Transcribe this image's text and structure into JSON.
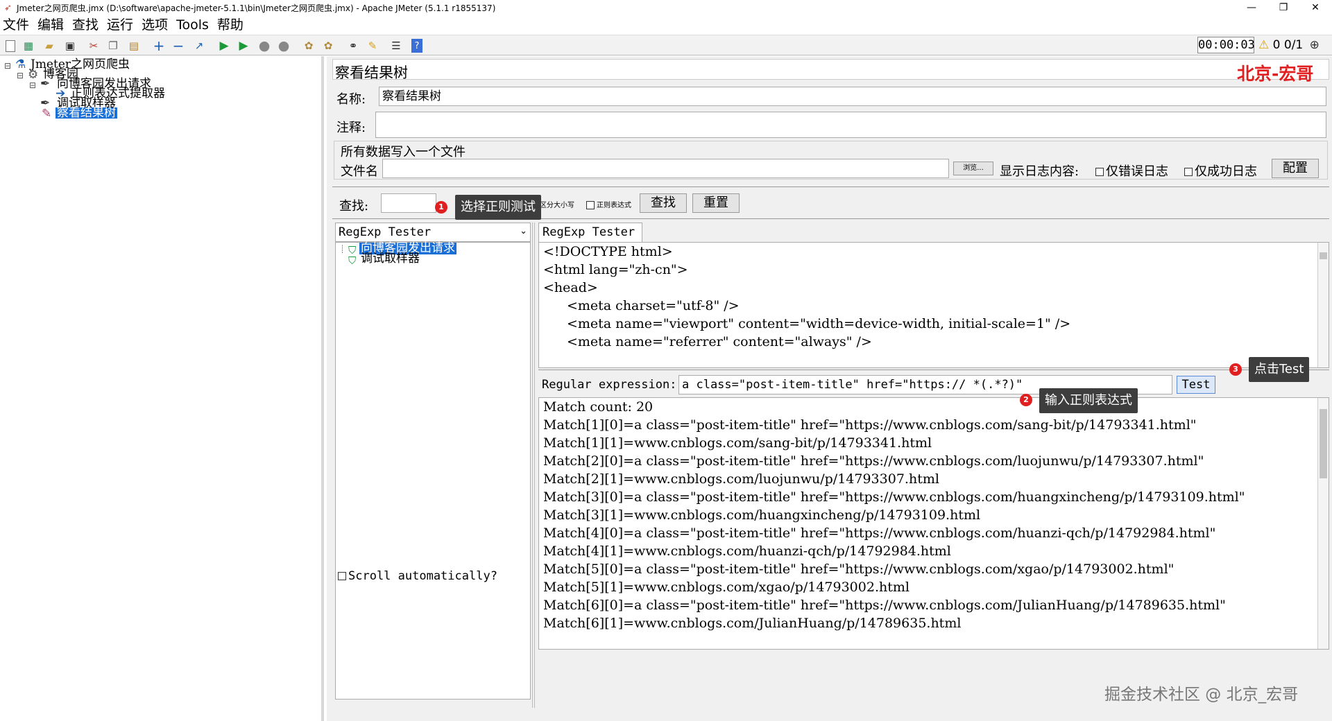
{
  "window": {
    "title": "Jmeter之网页爬虫.jmx (D:\\software\\apache-jmeter-5.1.1\\bin\\Jmeter之网页爬虫.jmx) - Apache JMeter (5.1.1 r1855137)",
    "minimize": "—",
    "maximize": "❐",
    "close": "✕"
  },
  "menu": [
    "文件",
    "编辑",
    "查找",
    "运行",
    "选项",
    "Tools",
    "帮助"
  ],
  "status": {
    "timer": "00:00:03",
    "errors": "0",
    "threads": "0/1"
  },
  "tree": {
    "root": "Jmeter之网页爬虫",
    "group": "博客园",
    "request": "向博客园发出请求",
    "extractor": "正则表达式提取器",
    "debug": "调试取样器",
    "listener": "察看结果树"
  },
  "panel": {
    "title": "察看结果树",
    "watermark_top": "北京-宏哥",
    "name_label": "名称:",
    "name_value": "察看结果树",
    "comment_label": "注释:",
    "comment_value": "",
    "file_section": "所有数据写入一个文件",
    "file_label": "文件名",
    "file_value": "",
    "browse": "浏览...",
    "log_label": "显示日志内容:",
    "errors_only": "仅错误日志",
    "success_only": "仅成功日志",
    "configure": "配置",
    "search_label": "查找:",
    "search_value": "",
    "case_label": "区分大小写",
    "regex_label": "正则表达式",
    "find_btn": "查找",
    "reset_btn": "重置"
  },
  "renderer": {
    "selected": "RegExp Tester",
    "tab": "RegExp Tester",
    "samples": [
      "向博客园发出请求",
      "调试取样器"
    ],
    "scroll_auto": "Scroll automatically?"
  },
  "response_lines": [
    "<!DOCTYPE html>",
    "<html lang=\"zh-cn\">",
    "<head>",
    "    <meta charset=\"utf-8\" />",
    "    <meta name=\"viewport\" content=\"width=device-width, initial-scale=1\" />",
    "    <meta name=\"referrer\" content=\"always\" />"
  ],
  "regex": {
    "label": "Regular expression:",
    "value": "a class=\"post-item-title\" href=\"https:// *(.*?)\"",
    "test_btn": "Test"
  },
  "results": [
    "Match count: 20",
    "Match[1][0]=a class=\"post-item-title\" href=\"https://www.cnblogs.com/sang-bit/p/14793341.html\"",
    "Match[1][1]=www.cnblogs.com/sang-bit/p/14793341.html",
    "Match[2][0]=a class=\"post-item-title\" href=\"https://www.cnblogs.com/luojunwu/p/14793307.html\"",
    "Match[2][1]=www.cnblogs.com/luojunwu/p/14793307.html",
    "Match[3][0]=a class=\"post-item-title\" href=\"https://www.cnblogs.com/huangxincheng/p/14793109.html\"",
    "Match[3][1]=www.cnblogs.com/huangxincheng/p/14793109.html",
    "Match[4][0]=a class=\"post-item-title\" href=\"https://www.cnblogs.com/huanzi-qch/p/14792984.html\"",
    "Match[4][1]=www.cnblogs.com/huanzi-qch/p/14792984.html",
    "Match[5][0]=a class=\"post-item-title\" href=\"https://www.cnblogs.com/xgao/p/14793002.html\"",
    "Match[5][1]=www.cnblogs.com/xgao/p/14793002.html",
    "Match[6][0]=a class=\"post-item-title\" href=\"https://www.cnblogs.com/JulianHuang/p/14789635.html\"",
    "Match[6][1]=www.cnblogs.com/JulianHuang/p/14789635.html"
  ],
  "annotations": {
    "step1_num": "1",
    "step1": "选择正则测试",
    "step2_num": "2",
    "step2": "输入正则表达式",
    "step3_num": "3",
    "step3": "点击Test"
  },
  "watermark_bottom": "掘金技术社区 @ 北京_宏哥",
  "colors": {
    "selection": "#1a6fd6",
    "accent_red": "#e02020",
    "tooltip_bg": "#3d3d3d"
  }
}
